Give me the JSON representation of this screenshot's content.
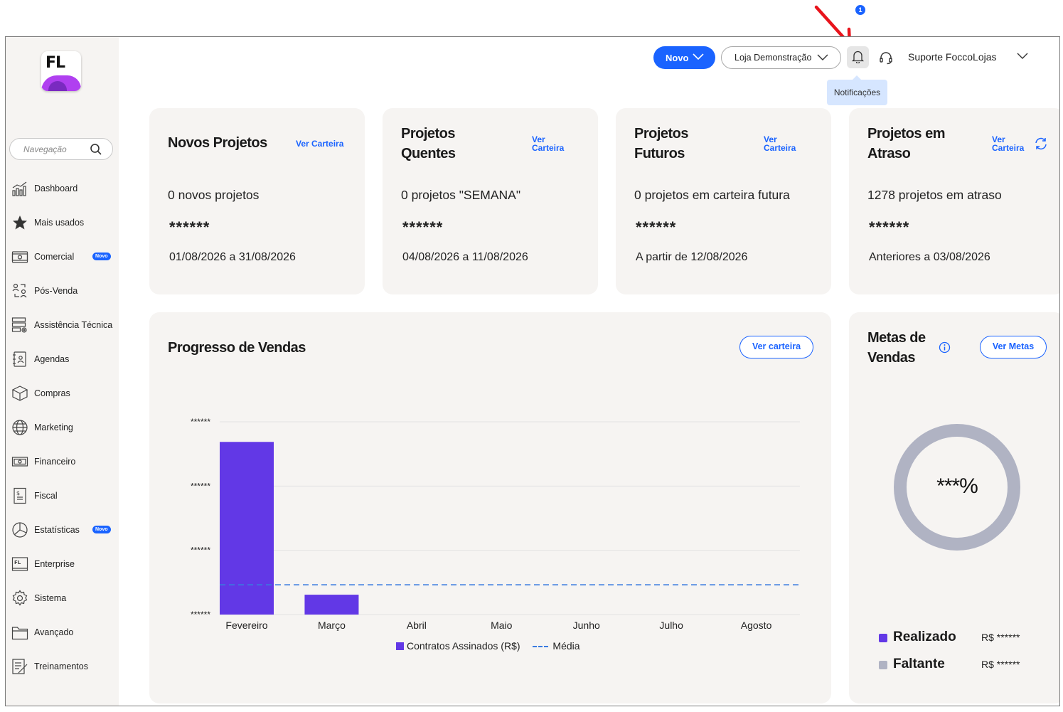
{
  "header": {
    "new_button": "Novo",
    "store_selector": "Loja Demonstração",
    "notifications_count": "1",
    "notifications_tooltip": "Notificações",
    "user_menu": "Suporte FoccoLojas"
  },
  "sidebar": {
    "logo_text": "FL",
    "search_placeholder": "Navegação",
    "items": [
      {
        "label": "Dashboard",
        "icon": "chart-bars-icon"
      },
      {
        "label": "Mais usados",
        "icon": "star-icon"
      },
      {
        "label": "Comercial",
        "icon": "wallet-icon",
        "badge": "Novo"
      },
      {
        "label": "Pós-Venda",
        "icon": "people-exchange-icon"
      },
      {
        "label": "Assistência Técnica",
        "icon": "server-gear-icon"
      },
      {
        "label": "Agendas",
        "icon": "contact-book-icon"
      },
      {
        "label": "Compras",
        "icon": "box-icon"
      },
      {
        "label": "Marketing",
        "icon": "globe-icon"
      },
      {
        "label": "Financeiro",
        "icon": "money-icon"
      },
      {
        "label": "Fiscal",
        "icon": "receipt-icon"
      },
      {
        "label": "Estatísticas",
        "icon": "pie-chart-icon",
        "badge": "Novo"
      },
      {
        "label": "Enterprise",
        "icon": "enterprise-icon"
      },
      {
        "label": "Sistema",
        "icon": "gear-icon"
      },
      {
        "label": "Avançado",
        "icon": "folder-icon"
      },
      {
        "label": "Treinamentos",
        "icon": "training-icon"
      }
    ]
  },
  "cards": [
    {
      "title": "Novos Projetos",
      "link": "Ver Carteira",
      "count": "0 novos projetos",
      "masked": "******",
      "range": "01/08/2026 a 31/08/2026"
    },
    {
      "title_line1": "Projetos",
      "title_line2": "Quentes",
      "link_line1": "Ver",
      "link_line2": "Carteira",
      "count": "0 projetos \"SEMANA\"",
      "masked": "******",
      "range": "04/08/2026 a 11/08/2026"
    },
    {
      "title_line1": "Projetos",
      "title_line2": "Futuros",
      "link_line1": "Ver",
      "link_line2": "Carteira",
      "count": "0 projetos em carteira futura",
      "masked": "******",
      "range": "A partir de 12/08/2026"
    },
    {
      "title_line1": "Projetos em",
      "title_line2": "Atraso",
      "link_line1": "Ver",
      "link_line2": "Carteira",
      "count": "1278 projetos em atraso",
      "masked": "******",
      "range": "Anteriores a 03/08/2026"
    }
  ],
  "sales_progress": {
    "title": "Progresso de Vendas",
    "button": "Ver carteira"
  },
  "chart_data": {
    "type": "bar",
    "categories": [
      "Fevereiro",
      "Março",
      "Abril",
      "Maio",
      "Junho",
      "Julho",
      "Agosto"
    ],
    "series": [
      {
        "name": "Contratos Assinados (R$)",
        "values": [
          0.87,
          0.1,
          0,
          0,
          0,
          0,
          0
        ]
      },
      {
        "name": "Média",
        "type": "dashed-line",
        "value": 0.15
      }
    ],
    "y_tick_labels": [
      "******",
      "******",
      "******",
      "******"
    ],
    "ylim": [
      0,
      1
    ],
    "legend_position": "bottom",
    "colors": {
      "bars": "#6238e6",
      "average": "#3a7be0"
    }
  },
  "sales_goals": {
    "title_line1": "Metas de",
    "title_line2": "Vendas",
    "button": "Ver Metas",
    "percent": "***%",
    "realizado_label": "Realizado",
    "realizado_value": "R$ ******",
    "faltante_label": "Faltante",
    "faltante_value": "R$ ******",
    "colors": {
      "realizado": "#6238e6",
      "faltante": "#b0b3c3"
    }
  }
}
